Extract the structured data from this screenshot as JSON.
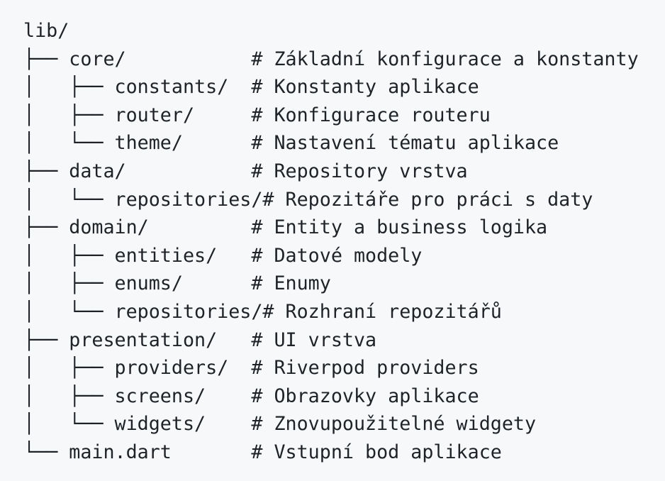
{
  "code_block": {
    "lines": [
      "lib/",
      "├── core/           # Základní konfigurace a konstanty",
      "│   ├── constants/  # Konstanty aplikace",
      "│   ├── router/     # Konfigurace routeru",
      "│   └── theme/      # Nastavení tématu aplikace",
      "├── data/           # Repository vrstva",
      "│   └── repositories/# Repozitáře pro práci s daty",
      "├── domain/         # Entity a business logika",
      "│   ├── entities/   # Datové modely",
      "│   ├── enums/      # Enumy",
      "│   └── repositories/# Rozhraní repozitářů",
      "├── presentation/   # UI vrstva",
      "│   ├── providers/  # Riverpod providers",
      "│   ├── screens/    # Obrazovky aplikace",
      "│   └── widgets/    # Znovupoužitelné widgety",
      "└── main.dart       # Vstupní bod aplikace"
    ]
  }
}
